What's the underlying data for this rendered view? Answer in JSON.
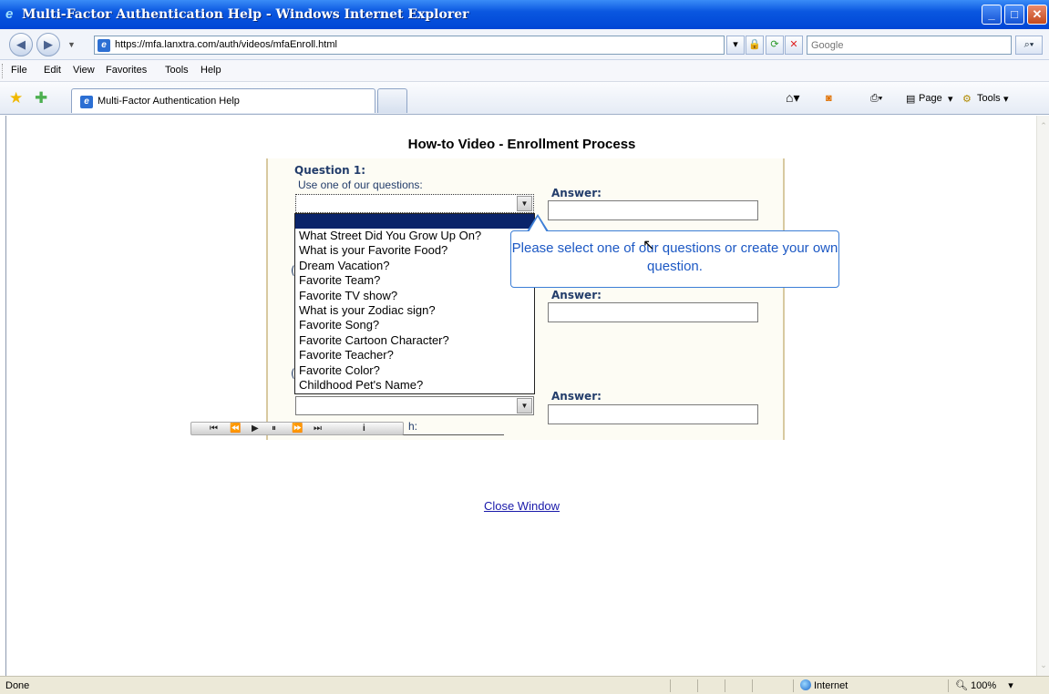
{
  "window": {
    "title": "Multi-Factor Authentication Help - Windows Internet Explorer",
    "minimize": "_",
    "maximize": "□",
    "close": "✕"
  },
  "address_bar": {
    "url": "https://mfa.lanxtra.com/auth/videos/mfaEnroll.html",
    "search_placeholder": "Google",
    "back_icon": "◀",
    "forward_icon": "▶"
  },
  "menu": {
    "items": [
      "File",
      "Edit",
      "View",
      "Favorites",
      "Tools",
      "Help"
    ]
  },
  "favorites_bar": {
    "tab_label": "Multi-Factor Authentication Help",
    "page_label": "Page",
    "tools_label": "Tools"
  },
  "page": {
    "heading": "How-to Video - Enrollment Process",
    "question1_label": "Question 1:",
    "question1_sub": "Use one of our questions:",
    "answer_label": "Answer:",
    "partial_q2_letter": "(",
    "partial_q3_letter": "(",
    "partial_text": "h:",
    "dropdown_options": [
      "What Street Did You Grow Up On?",
      "What is your Favorite Food?",
      "Dream Vacation?",
      "Favorite Team?",
      "Favorite TV show?",
      "What is your Zodiac sign?",
      "Favorite Song?",
      "Favorite Cartoon Character?",
      "Favorite Teacher?",
      "Favorite Color?",
      "Childhood Pet's Name?"
    ],
    "tooltip": "Please select one of our questions or create your own question.",
    "close_link": "Close Window"
  },
  "player": {
    "controls": [
      "⏮",
      "⏪",
      "▶",
      "⏸",
      "⏩",
      "⏭"
    ],
    "info": "i"
  },
  "status_bar": {
    "status": "Done",
    "zone": "Internet",
    "zoom": "100%"
  }
}
